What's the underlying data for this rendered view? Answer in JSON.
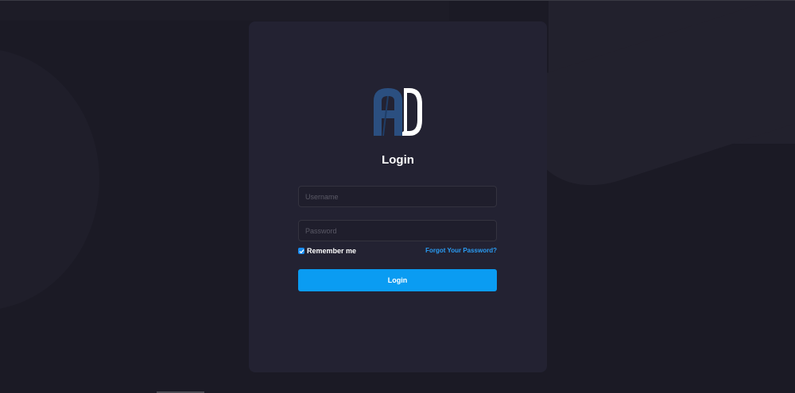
{
  "login_card": {
    "logo": {
      "icon": "ad-logo",
      "colors": {
        "a": "#2b4f80",
        "d": "#ffffff"
      }
    },
    "title": "Login",
    "username": {
      "placeholder": "Username",
      "value": ""
    },
    "password": {
      "placeholder": "Password",
      "value": ""
    },
    "remember_me": {
      "label": "Remember me",
      "checked": true
    },
    "forgot_password": "Forgot Your Password?",
    "submit_label": "Login"
  },
  "theme": {
    "background": "#1b1a25",
    "card": "#232232",
    "accent": "#0a9cf2",
    "link": "#2a9cf3"
  }
}
